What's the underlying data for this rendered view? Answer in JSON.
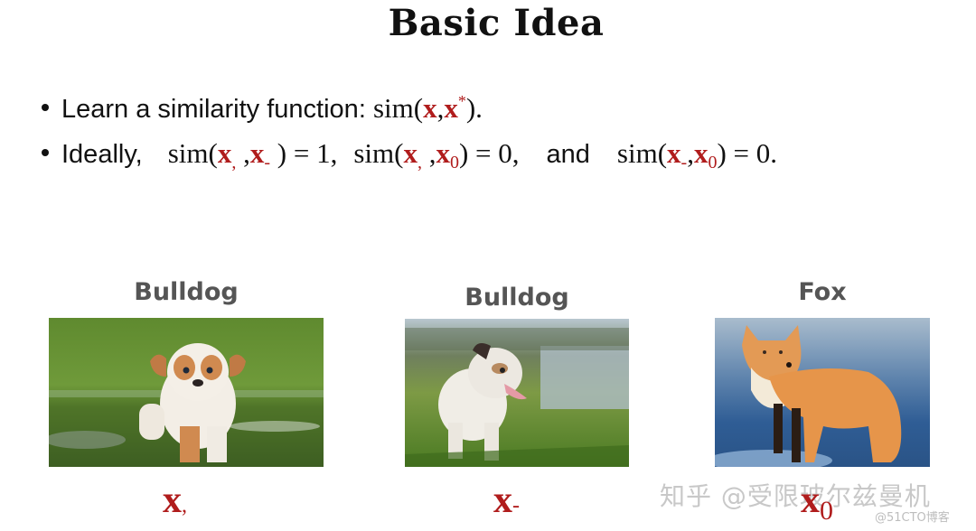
{
  "slide": {
    "title": "Basic Idea",
    "bullets": [
      {
        "prefix": "Learn a similarity function: ",
        "sim": "sim(",
        "x": "x",
        "comma": ",",
        "xstar": "x",
        "star": "*",
        "close": ").",
        "full_text": "Learn a similarity function: sim(x, x*)."
      },
      {
        "prefix": "Ideally,",
        "expr1": {
          "sim": "sim(",
          "a": "x",
          "a_sub": ",",
          "sep": " ,",
          "b": "x",
          "b_sub": "-",
          "close": " ) = 1,"
        },
        "expr2": {
          "sim": "sim(",
          "a": "x",
          "a_sub": ",",
          "sep": " ,",
          "b": "x",
          "b_sub": "0",
          "close": ") = 0,"
        },
        "and": "and",
        "expr3": {
          "sim": "sim(",
          "a": "x",
          "a_sub": "-",
          "sep": ",",
          "b": "x",
          "b_sub": "0",
          "close": ") = 0."
        },
        "full_text": "Ideally, sim(x, x-) = 1, sim(x, x0) = 0, and sim(x-, x0) = 0."
      }
    ],
    "examples": [
      {
        "label": "Bulldog",
        "image": "bulldog-puppy-in-water",
        "var": "x",
        "var_sub": ","
      },
      {
        "label": "Bulldog",
        "image": "bulldog-on-grass",
        "var": "x",
        "var_sub": "-"
      },
      {
        "label": "Fox",
        "image": "red-fox-in-snow",
        "var": "x",
        "var_sub": "0"
      }
    ],
    "colors": {
      "accent": "#b01c1c",
      "label": "#555555",
      "text": "#111111"
    }
  },
  "watermark": {
    "main": "知乎 @受限玻尔兹曼机",
    "secondary": "@51CTO博客"
  }
}
